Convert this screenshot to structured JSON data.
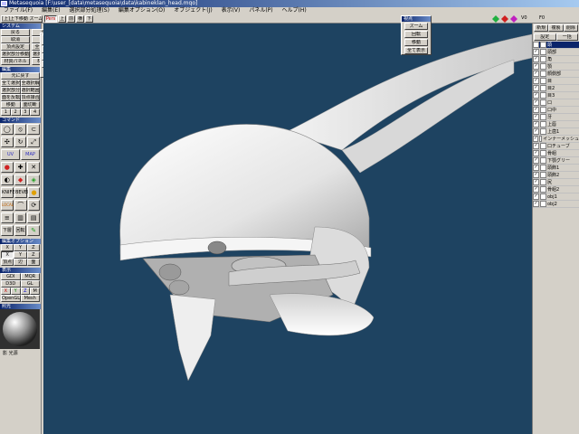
{
  "window": {
    "title": "Metasequoia [F:\\user_[data\\metasequoia\\data\\kabineklan_head.mqo]"
  },
  "menu": [
    "ファイル(F)",
    "編集(E)",
    "選択部分処理(S)",
    "編集オプション(O)",
    "オブジェクト(J)",
    "表示(V)",
    "パネル(P)",
    "ヘルプ(H)"
  ],
  "toolbar": {
    "mode_label": "[上]上下移動 ズーム",
    "view_persp": "Pers",
    "view_buttons": [
      "上",
      "前",
      "横",
      "下"
    ],
    "v_label": "V0",
    "f_label": "F0"
  },
  "accent_colors": {
    "titlebar": "#0a246a",
    "viewport": "#1e4361",
    "view_green": "#20b040",
    "view_red": "#d02020",
    "view_magenta": "#c020c0"
  },
  "left": {
    "section_system": "システム",
    "system_row1": [
      "戻る",
      "保存"
    ],
    "system_row2": [
      "取消",
      "挿入"
    ],
    "system_row3": [
      "頂点設定",
      "全選択反転"
    ],
    "system_row4": [
      "選択部分移動",
      "選択部分整列"
    ],
    "system_row5": [
      "材質パネル",
      "材質設定"
    ],
    "axes": [
      [
        "X",
        "X",
        "X"
      ],
      [
        "Y",
        "Y",
        "Y"
      ],
      [
        "Z",
        "Z",
        "Z"
      ]
    ],
    "section_edit": "編集",
    "edit_row1": [
      "元に戻す"
    ],
    "edit_row2": [
      "全て選択",
      "全選択解除"
    ],
    "edit_row3": [
      "選択部分削除",
      "選択範囲"
    ],
    "edit_row4": [
      "面を反転",
      "頂点接合"
    ],
    "edit_row5": [
      "移動",
      "面切断"
    ],
    "numrow": [
      "1",
      "2",
      "3",
      "4"
    ],
    "section_command": "コマンド",
    "command_labels": [
      "UV",
      "MAP",
      "KNIFE",
      "BEVEL",
      "SPHERE",
      "BEND",
      "下層",
      "回転",
      "LOCAL"
    ],
    "section_editopt": "編集オプション",
    "editopt_row1": [
      "X",
      "Y",
      "Z"
    ],
    "editopt_row2": [
      "X",
      "Y",
      "Z"
    ],
    "editopt_row3": [
      "頂点",
      "辺",
      "面"
    ],
    "section_display": "表示",
    "display_row1": [
      "GDI",
      "MQR"
    ],
    "display_row2": [
      "D3D",
      "GL"
    ],
    "display_row3": [
      "X",
      "Y",
      "Z",
      "M"
    ],
    "display_row4": [
      "OpenGL",
      "Mesh"
    ],
    "section_light": "照光",
    "light_label": "光源",
    "light_check": "影"
  },
  "float_window": {
    "title": "視点",
    "buttons": [
      "ズーム",
      "回転",
      "移動",
      "全て表示",
      "FU"
    ]
  },
  "right": {
    "tabs": [
      "新規",
      "複製",
      "削除"
    ],
    "subtabs": [
      "設定",
      "一括"
    ],
    "layers": [
      {
        "name": "頭",
        "selected": true
      },
      {
        "name": "頭部",
        "selected": false
      },
      {
        "name": "角",
        "selected": false
      },
      {
        "name": "顎",
        "selected": false
      },
      {
        "name": "顔側部",
        "selected": false
      },
      {
        "name": "目",
        "selected": false
      },
      {
        "name": "目2",
        "selected": false
      },
      {
        "name": "目3",
        "selected": false
      },
      {
        "name": "口",
        "selected": false
      },
      {
        "name": "口中",
        "selected": false
      },
      {
        "name": "牙",
        "selected": false
      },
      {
        "name": "上唇",
        "selected": false
      },
      {
        "name": "上歯1",
        "selected": false
      },
      {
        "name": "インナーメッシュ",
        "selected": false
      },
      {
        "name": "口チューブ",
        "selected": false
      },
      {
        "name": "骨組",
        "selected": false
      },
      {
        "name": "下顎グリー",
        "selected": false
      },
      {
        "name": "頭飾1",
        "selected": false
      },
      {
        "name": "頭飾2",
        "selected": false
      },
      {
        "name": "尻",
        "selected": false
      },
      {
        "name": "骨組2",
        "selected": false
      },
      {
        "name": "obj1",
        "selected": false
      },
      {
        "name": "obj2",
        "selected": false
      }
    ]
  }
}
